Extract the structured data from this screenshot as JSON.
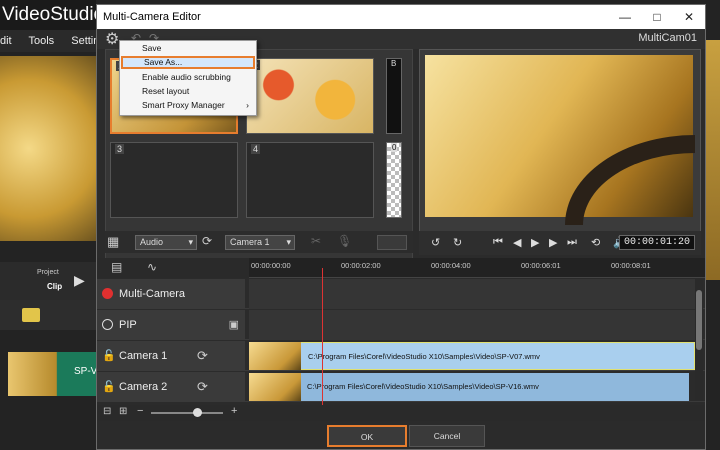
{
  "background_app": {
    "title": "VideoStudio X",
    "menu": [
      "dit",
      "Tools",
      "Settings"
    ],
    "project_label": "Project",
    "clip_label": "Clip",
    "clip_thumb_label": "SP-V"
  },
  "dialog": {
    "title": "Multi-Camera Editor",
    "project_name": "MultiCam01",
    "window_minimize": "—",
    "window_maximize": "□",
    "window_close": "✕"
  },
  "context_menu": {
    "items": [
      {
        "label": "Save"
      },
      {
        "label": "Save As..."
      },
      {
        "label": "Enable audio scrubbing"
      },
      {
        "label": "Reset layout"
      },
      {
        "label": "Smart Proxy Manager"
      }
    ],
    "submenu_arrow": "›"
  },
  "source_cells": [
    "1",
    "2",
    "3",
    "4"
  ],
  "meters": [
    "B",
    "0"
  ],
  "source_toolbar": {
    "audio_dropdown": "Audio",
    "camera_dropdown": "Camera 1"
  },
  "preview": {
    "timecode": "00:00:01:20"
  },
  "timeline": {
    "ticks": [
      "00:00:00:00",
      "00:00:02:00",
      "00:00:04:00",
      "00:00:06:01",
      "00:00:08:01"
    ],
    "tracks": [
      {
        "label": "Multi-Camera"
      },
      {
        "label": "PIP"
      },
      {
        "label": "Camera 1",
        "clip": "C:\\Program Files\\Corel\\VideoStudio X10\\Samples\\Video\\SP-V07.wmv"
      },
      {
        "label": "Camera 2",
        "clip": "C:\\Program Files\\Corel\\VideoStudio X10\\Samples\\Video\\SP-V16.wmv"
      }
    ]
  },
  "buttons": {
    "ok": "OK",
    "cancel": "Cancel"
  },
  "colors": {
    "highlight": "#e77d2e",
    "clip": "#a9cfee",
    "playhead": "#dd3333",
    "record": "#e03030"
  }
}
